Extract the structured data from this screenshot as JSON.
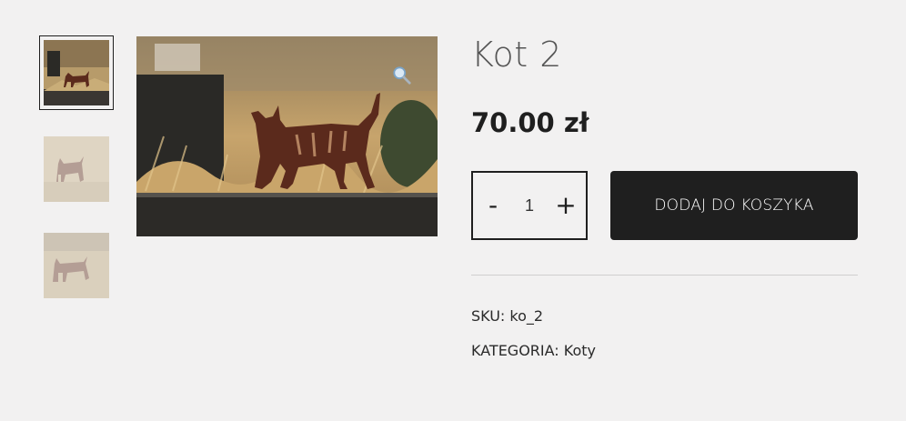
{
  "product": {
    "title": "Kot 2",
    "price": "70.00 zł",
    "quantity": "1",
    "add_to_cart_label": "DODAJ DO KOSZYKA",
    "sku_label": "SKU:",
    "sku_value": "ko_2",
    "category_label": "KATEGORIA:",
    "category_value": "Koty"
  },
  "quantity_controls": {
    "minus": "-",
    "plus": "+"
  },
  "gallery": {
    "thumbnails": [
      "cat-silhouette-garden",
      "cat-silhouette-garden",
      "cat-silhouette-garden"
    ],
    "active_index": 0,
    "main_image": "rusty-metal-cat-silhouette-in-grass",
    "zoom_icon": "magnifier-icon"
  },
  "colors": {
    "button_bg": "#1f1f1f",
    "page_bg": "#f2f1f1",
    "cat_rust": "#5b2a1c"
  }
}
